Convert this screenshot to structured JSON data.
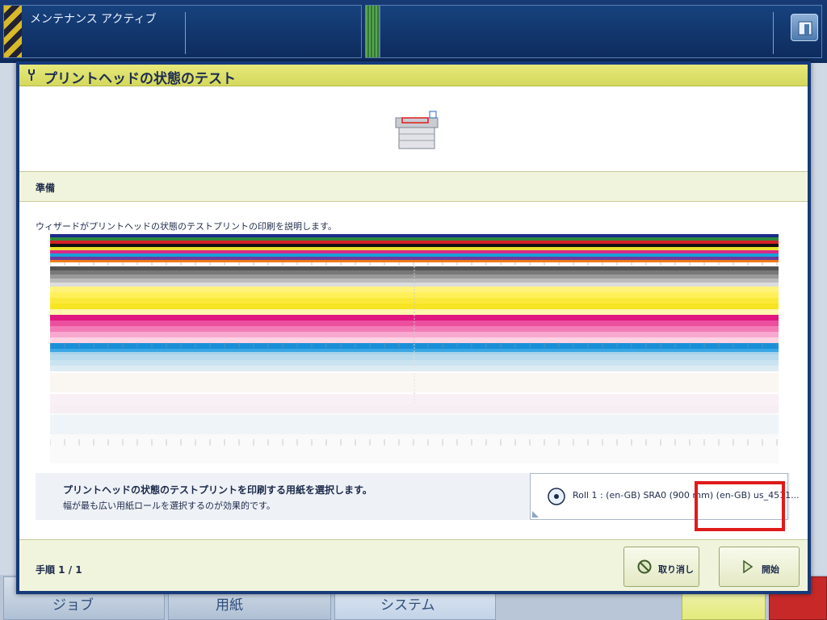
{
  "topbar": {
    "mode_label": "メンテナンス アクティブ"
  },
  "bottomnav": {
    "tabs": [
      {
        "label": "ジョブ"
      },
      {
        "label": "用紙"
      },
      {
        "label": "システム"
      }
    ]
  },
  "dialog": {
    "title": "プリントヘッドの状態のテスト",
    "section_header": "準備",
    "description": "ウィザードがプリントヘッドの状態のテストプリントの印刷を説明します。",
    "paper_prompt": "プリントヘッドの状態のテストプリントを印刷する用紙を選択します。",
    "paper_hint": "幅が最も広い用紙ロールを選択するのが効果的です。",
    "paper_selection": "Roll 1 : (en-GB) SRA0 (900 mm) (en-GB) us_4511...",
    "step": "手順 1 / 1",
    "cancel_label": "取り消し",
    "start_label": "開始"
  },
  "colors": {
    "title_bar": "#d4d85c",
    "frame": "#163a7a",
    "highlight": "#e01a1a"
  }
}
